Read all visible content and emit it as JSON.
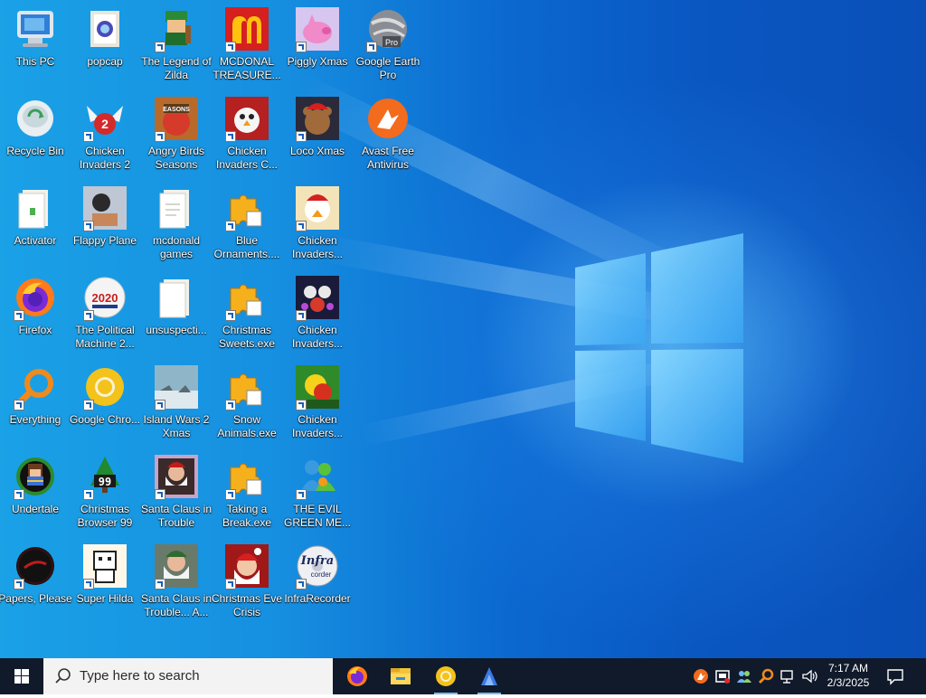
{
  "desktop": {
    "icons": [
      {
        "label": "This PC"
      },
      {
        "label": "Recycle Bin"
      },
      {
        "label": "Activator"
      },
      {
        "label": "Firefox"
      },
      {
        "label": "Everything"
      },
      {
        "label": "Undertale"
      },
      {
        "label": "Papers, Please"
      },
      {
        "label": "popcap"
      },
      {
        "label": "Chicken Invaders 2"
      },
      {
        "label": "Flappy Plane"
      },
      {
        "label": "The Political Machine 2..."
      },
      {
        "label": "Google Chro..."
      },
      {
        "label": "Christmas Browser 99"
      },
      {
        "label": "Super Hilda"
      },
      {
        "label": "The Legend of Zilda"
      },
      {
        "label": "Angry Birds Seasons"
      },
      {
        "label": "mcdonald games"
      },
      {
        "label": "unsuspecti..."
      },
      {
        "label": "Island Wars 2 Xmas"
      },
      {
        "label": "Santa Claus in Trouble"
      },
      {
        "label": "Santa Claus in Trouble... A..."
      },
      {
        "label": "MCDONAL TREASURE..."
      },
      {
        "label": "Chicken Invaders C..."
      },
      {
        "label": "Blue Ornaments...."
      },
      {
        "label": "Christmas Sweets.exe"
      },
      {
        "label": "Snow Animals.exe"
      },
      {
        "label": "Taking a Break.exe"
      },
      {
        "label": "Christmas Eve Crisis"
      },
      {
        "label": "Piggly Xmas"
      },
      {
        "label": "Loco Xmas"
      },
      {
        "label": "Chicken Invaders..."
      },
      {
        "label": "Chicken Invaders..."
      },
      {
        "label": "Chicken Invaders..."
      },
      {
        "label": "THE EVIL GREEN ME..."
      },
      {
        "label": "InfraRecorder"
      },
      {
        "label": "Google Earth Pro"
      },
      {
        "label": "Avast Free Antivirus"
      }
    ],
    "badges": {
      "google_earth": "Pro",
      "chicken_invaders_2": "2",
      "political_machine": "2020",
      "christmas_browser": "99",
      "angry_birds": "EASONS",
      "infra_top": "Infra",
      "infra_bottom": "corder"
    }
  },
  "taskbar": {
    "search_placeholder": "Type here to search",
    "apps": [
      "firefox-icon",
      "file-explorer-icon",
      "google-chrome-icon",
      "app-icon"
    ],
    "tray": [
      "avast-tray-icon",
      "security-tray-icon",
      "people-tray-icon",
      "everything-tray-icon",
      "network-icon",
      "volume-icon"
    ],
    "time": "7:17 AM",
    "date": "2/3/2025"
  },
  "colors": {
    "taskbar": "#101a2b",
    "desktop_blue": "#0a68cf",
    "accent": "#7ab8f5"
  }
}
